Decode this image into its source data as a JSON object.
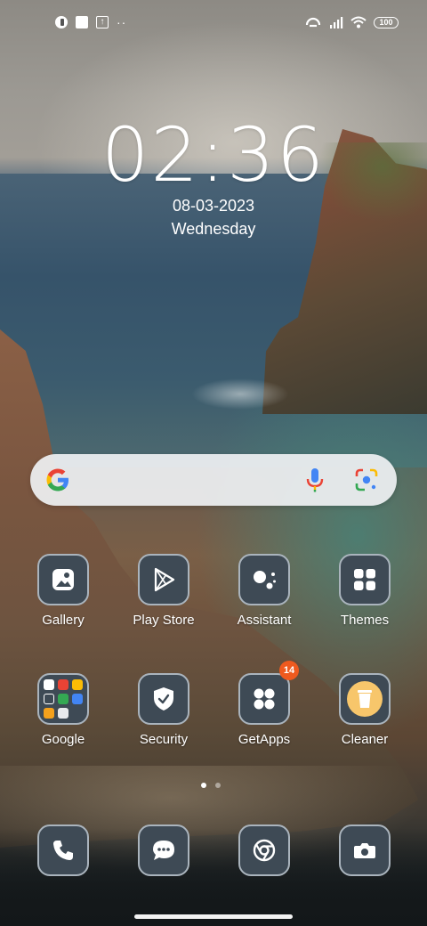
{
  "status_bar": {
    "left_icons": [
      "app-notification-icon",
      "square-notification-icon",
      "upload-notification-icon"
    ],
    "more_indicator": "··",
    "right_icons": [
      "hotspot-icon",
      "signal-icon",
      "wifi-icon"
    ],
    "battery": "100"
  },
  "clock": {
    "time": "02:36",
    "date": "08-03-2023",
    "weekday": "Wednesday"
  },
  "search": {
    "icons": [
      "google-logo-icon",
      "microphone-icon",
      "google-lens-icon"
    ]
  },
  "apps": {
    "row1": [
      {
        "label": "Gallery",
        "icon": "gallery-icon"
      },
      {
        "label": "Play Store",
        "icon": "play-store-icon"
      },
      {
        "label": "Assistant",
        "icon": "assistant-icon"
      },
      {
        "label": "Themes",
        "icon": "themes-icon"
      }
    ],
    "row2": [
      {
        "label": "Google",
        "icon": "google-folder-icon"
      },
      {
        "label": "Security",
        "icon": "security-icon"
      },
      {
        "label": "GetApps",
        "icon": "getapps-icon",
        "badge": "14"
      },
      {
        "label": "Cleaner",
        "icon": "cleaner-icon"
      }
    ]
  },
  "page_indicator": {
    "pages": 2,
    "current": 1
  },
  "dock": [
    {
      "icon": "phone-icon"
    },
    {
      "icon": "messages-icon"
    },
    {
      "icon": "chrome-icon"
    },
    {
      "icon": "camera-icon"
    }
  ],
  "colors": {
    "icon_bg": "#3e4a55",
    "icon_border": "#aab4bd",
    "badge": "#ef5a1f",
    "cleaner": "#f7c66b",
    "search_bg": "#eef0f2"
  }
}
